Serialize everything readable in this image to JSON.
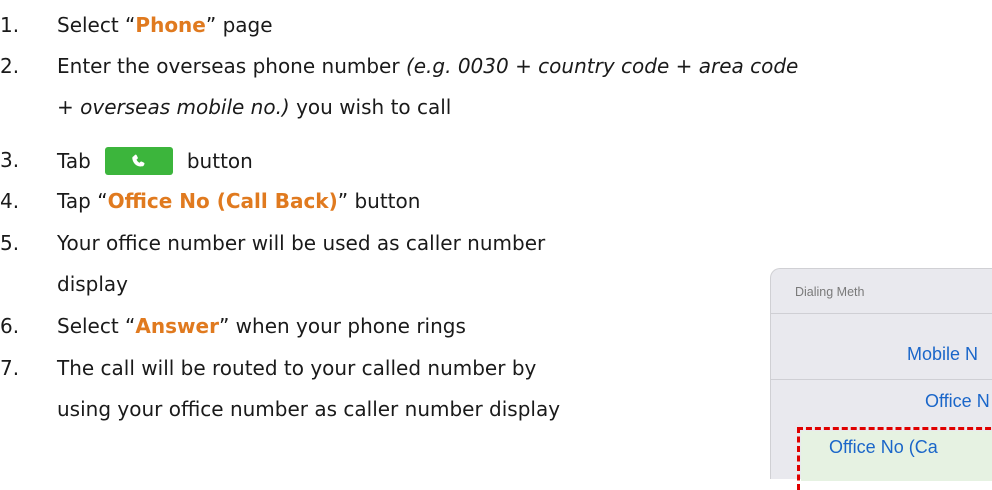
{
  "steps": [
    {
      "num": "1.",
      "pre": "Select “",
      "highlight": "Phone",
      "post": "” page"
    },
    {
      "num": "2.",
      "pre": "Enter the overseas phone number ",
      "italic": "(e.g. 0030 + country code + area code",
      "cont_italic": "+ overseas mobile no.)",
      "cont_post": " you wish to call"
    },
    {
      "num": "3.",
      "pre": "Tab",
      "post": "button",
      "icon": "phone-call-icon",
      "button_color": "#3cb53c"
    },
    {
      "num": "4.",
      "pre": "Tap “",
      "highlight": "Office No (Call Back)",
      "post": "” button"
    },
    {
      "num": "5.",
      "line1": "Your office number will be used as caller number",
      "line2": "display"
    },
    {
      "num": "6.",
      "pre": "Select “",
      "highlight": "Answer",
      "post": "” when your phone rings"
    },
    {
      "num": "7.",
      "line1": "The call will be routed to your called number by",
      "line2": "using your office number as caller number display"
    }
  ],
  "phone": {
    "title": "Dialing Meth",
    "options": [
      "Mobile N",
      "Office N",
      "Office No (Ca"
    ]
  },
  "colors": {
    "highlight": "#e07a1f",
    "dashed_border": "#e00000",
    "option_text": "#1a66c9"
  }
}
